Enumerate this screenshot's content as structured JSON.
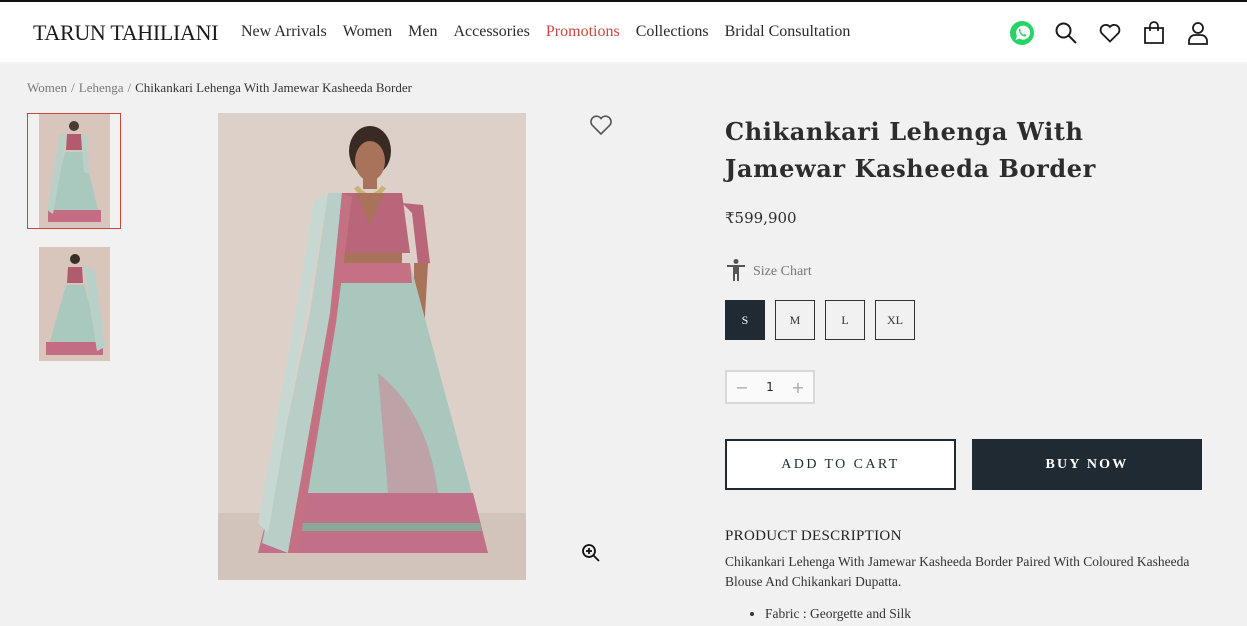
{
  "brand": {
    "logo_text": "TARUN TAHILIANI"
  },
  "nav": {
    "items": [
      {
        "label": "New Arrivals"
      },
      {
        "label": "Women"
      },
      {
        "label": "Men"
      },
      {
        "label": "Accessories"
      },
      {
        "label": "Promotions"
      },
      {
        "label": "Collections"
      },
      {
        "label": "Bridal Consultation"
      }
    ]
  },
  "header_icons": [
    "whatsapp-icon",
    "search-icon",
    "heart-icon",
    "bag-icon",
    "user-icon"
  ],
  "breadcrumb": {
    "items": [
      "Women",
      "Lehenga"
    ],
    "separator": "/",
    "current": "Chikankari Lehenga With Jamewar Kasheeda Border"
  },
  "product": {
    "title": "Chikankari Lehenga With Jamewar Kasheeda Border",
    "price": "₹599,900",
    "size_chart_label": "Size Chart",
    "sizes": [
      "S",
      "M",
      "L",
      "XL"
    ],
    "selected_size": "S",
    "quantity": "1",
    "add_to_cart_label": "ADD TO CART",
    "buy_now_label": "BUY NOW",
    "description_heading": "PRODUCT DESCRIPTION",
    "description": "Chikankari Lehenga With Jamewar Kasheeda Border Paired With Coloured Kasheeda Blouse And Chikankari Dupatta.",
    "details": [
      "Fabric : Georgette and Silk"
    ]
  },
  "colors": {
    "accent": "#c8483c",
    "primary_dark": "#1f2a33",
    "page_bg": "#f1f1f1",
    "whatsapp": "#25d366"
  }
}
